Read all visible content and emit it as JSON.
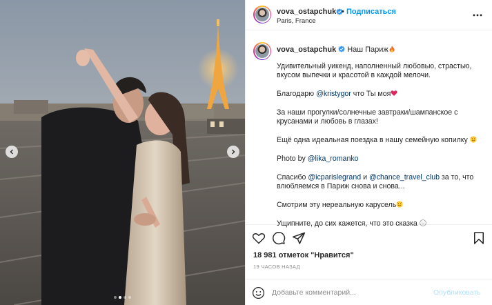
{
  "post": {
    "photo": {
      "alt": "vova_ostapchuk post photo",
      "carousel": {
        "slide_count": 4,
        "active_index": 1
      }
    },
    "header": {
      "username": "vova_ostapchuk",
      "verified": true,
      "separator": "•",
      "follow_label": "Подписаться",
      "location": "Paris, France"
    },
    "caption": {
      "username": "vova_ostapchuk",
      "headline": "Наш Париж",
      "headline_emoji": "fire-emoji",
      "paragraphs": [
        {
          "text": "Удивительный уикенд, наполненный любовью, страстью, вкусом выпечки и красотой в каждой мелочи."
        },
        {
          "before": "Благодарю ",
          "mention": "@kristygor",
          "after": " что Ты моя",
          "emoji": "heart-emoji"
        },
        {
          "text": "За наши прогулки/солнечные завтраки/шампанское с крусанами и любовь в глазах!"
        },
        {
          "before": "Ещё одна идеальная поездка в нашу семейную копилку ",
          "emoji": "smiling-face-hearts-emoji"
        },
        {
          "before": "Photo by ",
          "mention": "@lika_romanko"
        },
        {
          "before": "Спасибо ",
          "mention": "@icparislegrand",
          "middle": " и ",
          "mention2": "@chance_travel_club",
          "after": " за то, что влюбляемся в Париж снова и снова..."
        },
        {
          "before": "Смотрим эту нереальную карусель",
          "emoji": "smiling-face-hearts-emoji"
        },
        {
          "before": "Ущипните, до сих кажется, что это сказка ",
          "emoji": "smiling-face-emoji"
        }
      ]
    },
    "actions": {
      "like_icon": "heart-outline-icon",
      "comment_icon": "comment-icon",
      "share_icon": "share-icon",
      "save_icon": "bookmark-icon"
    },
    "likes_text": "18 981 отметок \"Нравится\"",
    "time_ago": "19 ЧАСОВ НАЗАД",
    "comment": {
      "placeholder": "Добавьте комментарий...",
      "value": "",
      "publish_label": "Опубликовать"
    },
    "colors": {
      "accent": "#0095f6",
      "publish_disabled": "#b2dffc",
      "mention": "#00376b",
      "verified": "#3897f0",
      "border": "#efefef"
    }
  }
}
